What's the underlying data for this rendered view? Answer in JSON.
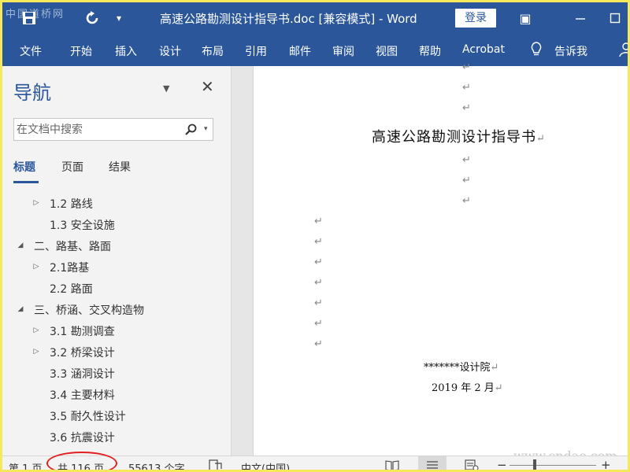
{
  "titlebar": {
    "watermark": "中国道桥网",
    "doc_title": "高速公路勘测设计指导书.doc [兼容模式]  -  Word",
    "login_label": "登录",
    "qat_dropdown_glyph": "▾",
    "restore_glyph": "▣",
    "maximize_glyph": "☐"
  },
  "ribbon": {
    "tabs": [
      "文件",
      "开始",
      "插入",
      "设计",
      "布局",
      "引用",
      "邮件",
      "审阅",
      "视图",
      "帮助",
      "Acrobat"
    ],
    "tell_me": "告诉我"
  },
  "nav": {
    "title": "导航",
    "dropdown_glyph": "▼",
    "close_glyph": "✕",
    "search": {
      "placeholder": "在文档中搜索",
      "dropdown_glyph": "▾"
    },
    "tabs": [
      "标题",
      "页面",
      "结果"
    ],
    "tree": [
      {
        "label": "1.2  路线",
        "caret": "▷"
      },
      {
        "label": "1.3  安全设施",
        "caret": ""
      },
      {
        "label": "二、路基、路面",
        "caret": "◢"
      },
      {
        "label": "2.1路基",
        "caret": "▷"
      },
      {
        "label": "2.2  路面",
        "caret": ""
      },
      {
        "label": "三、桥涵、交叉构造物",
        "caret": "◢"
      },
      {
        "label": "3.1  勘测调查",
        "caret": "▷"
      },
      {
        "label": "3.2  桥梁设计",
        "caret": "▷"
      },
      {
        "label": "3.3  涵洞设计",
        "caret": ""
      },
      {
        "label": "3.4  主要材料",
        "caret": ""
      },
      {
        "label": "3.5  耐久性设计",
        "caret": ""
      },
      {
        "label": "3.6  抗震设计",
        "caret": ""
      }
    ]
  },
  "document": {
    "paragraph_mark": "↵",
    "heading": "高速公路勘测设计指导书",
    "org": "*******设计院",
    "date": "2019 年 2 月",
    "watermark": "www.cndao.com"
  },
  "status": {
    "page": "第 1 页",
    "total": "共 116 页",
    "words": "55613 个字",
    "language": "中文(中国)",
    "zoom_out": "−",
    "zoom_in": "+"
  }
}
